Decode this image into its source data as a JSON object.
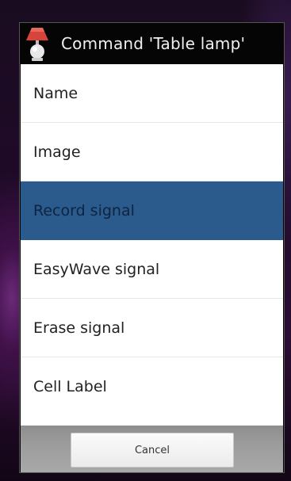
{
  "dialog": {
    "title": "Command 'Table lamp'",
    "icon": "table-lamp-icon"
  },
  "menu": {
    "items": [
      {
        "label": "Name"
      },
      {
        "label": "Image"
      },
      {
        "label": "Record signal",
        "selected": true
      },
      {
        "label": "EasyWave signal"
      },
      {
        "label": "Erase signal"
      },
      {
        "label": "Cell Label"
      }
    ]
  },
  "footer": {
    "cancel_label": "Cancel"
  },
  "colors": {
    "selected_background": "#2b5a8c",
    "title_background": "#050505",
    "lamp_shade": "#d8443a"
  }
}
